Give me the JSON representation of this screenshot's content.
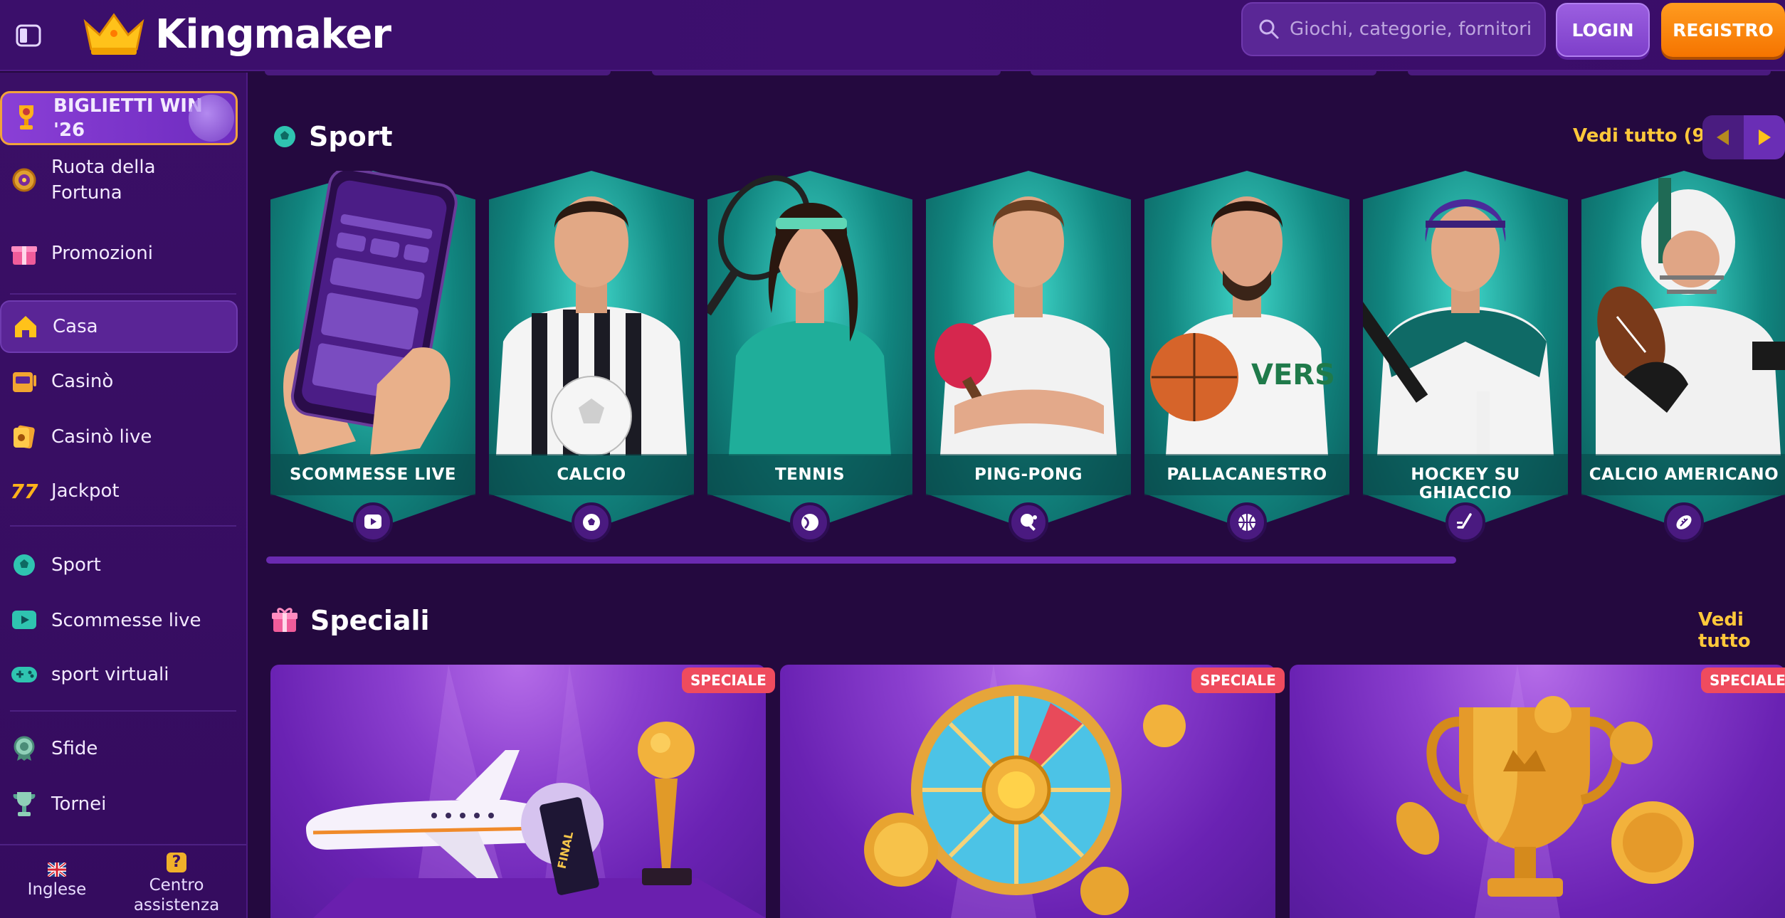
{
  "header": {
    "brand": "Kingmaker",
    "search_placeholder": "Giochi, categorie, fornitori",
    "login_label": "LOGIN",
    "register_label": "REGISTRO"
  },
  "sidebar": {
    "banner": {
      "label": "BIGLIETTI WIN '26",
      "icon": "trophy-icon"
    },
    "items": [
      {
        "label": "Ruota della Fortuna",
        "icon": "wheel-icon"
      },
      {
        "label": "Promozioni",
        "icon": "gift-icon"
      },
      {
        "label": "Casa",
        "icon": "home-icon",
        "active": true
      },
      {
        "label": "Casinò",
        "icon": "slot-machine-icon"
      },
      {
        "label": "Casinò live",
        "icon": "playing-card-icon"
      },
      {
        "label": "Jackpot",
        "icon": "sevens-icon"
      },
      {
        "label": "Sport",
        "icon": "soccer-ball-icon"
      },
      {
        "label": "Scommesse live",
        "icon": "play-screen-icon"
      },
      {
        "label": "sport virtuali",
        "icon": "gamepad-icon"
      },
      {
        "label": "Sfide",
        "icon": "medal-icon"
      },
      {
        "label": "Tornei",
        "icon": "cup-icon"
      }
    ],
    "footer": {
      "language": "Inglese",
      "help": "Centro assistenza"
    }
  },
  "sport_section": {
    "title": "Sport",
    "see_all": "Vedi tutto (9)",
    "cards": [
      {
        "label": "SCOMMESSE LIVE",
        "icon": "live-play-icon"
      },
      {
        "label": "CALCIO",
        "icon": "soccer-ball-icon"
      },
      {
        "label": "TENNIS",
        "icon": "tennis-ball-icon"
      },
      {
        "label": "PING-PONG",
        "icon": "ping-pong-icon"
      },
      {
        "label": "PALLACANESTRO",
        "icon": "basketball-icon"
      },
      {
        "label": "HOCKEY SU GHIACCIO",
        "icon": "hockey-stick-icon"
      },
      {
        "label": "CALCIO AMERICANO",
        "icon": "american-football-icon"
      }
    ]
  },
  "specials_section": {
    "title": "Speciali",
    "see_all": "Vedi tutto",
    "cards": [
      {
        "tag": "SPECIALE",
        "art": "airplane-trophy"
      },
      {
        "tag": "SPECIALE",
        "art": "prize-wheel"
      },
      {
        "tag": "SPECIALE",
        "art": "gold-cup"
      }
    ]
  },
  "colors": {
    "header_bg": "#3b0f6b",
    "page_bg": "#24093f",
    "accent_gold": "#ffc83a",
    "register_orange": "#f57400",
    "teal_card": "#11857f",
    "special_red": "#ef4b5e"
  }
}
